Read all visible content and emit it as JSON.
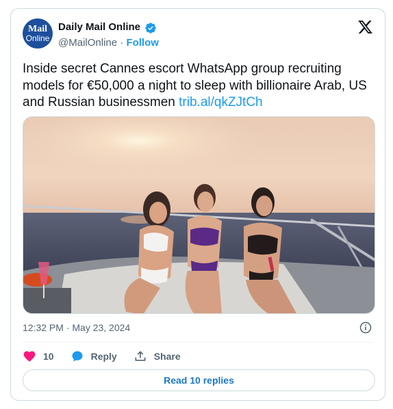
{
  "author": {
    "avatar_line1": "Mail",
    "avatar_line2": "Online",
    "name": "Daily Mail Online",
    "handle": "@MailOnline",
    "separator": "·",
    "follow_label": "Follow"
  },
  "tweet": {
    "text": "Inside secret Cannes escort WhatsApp group recruiting models for €50,000 a night to sleep with billionaire Arab, US and Russian businessmen ",
    "link": "trib.al/qkZJtCh",
    "timestamp": "12:32 PM · May 23, 2024"
  },
  "actions": {
    "like_count": "10",
    "reply_label": "Reply",
    "share_label": "Share"
  },
  "read_replies_label": "Read 10 replies",
  "colors": {
    "accent": "#1d9bf0",
    "like": "#f91880",
    "text": "#0f1419",
    "secondary": "#536471"
  }
}
